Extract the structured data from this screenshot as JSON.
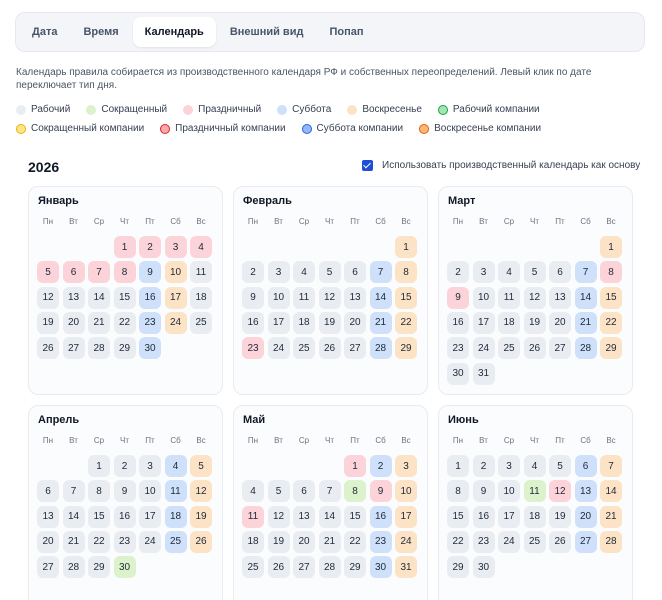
{
  "tabs": [
    "Дата",
    "Время",
    "Календарь",
    "Внешний вид",
    "Попап"
  ],
  "active_tab": 2,
  "description": "Календарь правила собирается из производственного календаря РФ и собственных переопределений. Левый клик по дате переключает тип дня.",
  "legend_row1": [
    {
      "label": "Рабочий",
      "color": "#e9edf2",
      "ring": "#e9edf2"
    },
    {
      "label": "Сокращенный",
      "color": "#dcf2cc",
      "ring": "#dcf2cc"
    },
    {
      "label": "Праздничный",
      "color": "#fbd3d8",
      "ring": "#fbd3d8"
    },
    {
      "label": "Суббота",
      "color": "#cfe0fb",
      "ring": "#cfe0fb"
    },
    {
      "label": "Воскресенье",
      "color": "#fde3c6",
      "ring": "#fde3c6"
    },
    {
      "label": "Рабочий компании",
      "color": "#a7e3b4",
      "ring": "#16a34a"
    }
  ],
  "legend_row2": [
    {
      "label": "Сокращенный компании",
      "color": "#fde68a",
      "ring": "#eab308"
    },
    {
      "label": "Праздничный компании",
      "color": "#f9a8b0",
      "ring": "#dc2626"
    },
    {
      "label": "Суббота компании",
      "color": "#93b8f7",
      "ring": "#2563eb"
    },
    {
      "label": "Воскресенье компании",
      "color": "#fdba74",
      "ring": "#ea580c"
    }
  ],
  "year": "2026",
  "use_basis_label": "Использовать производственный календарь как основу",
  "use_basis_checked": true,
  "weekdays": [
    "Пн",
    "Вт",
    "Ср",
    "Чт",
    "Пт",
    "Сб",
    "Вс"
  ],
  "day_colors": {
    "W": "#e9edf2",
    "S": "#dcf2cc",
    "H": "#fbd3d8",
    "A": "#cfe0fb",
    "U": "#fde3c6"
  },
  "months": [
    {
      "name": "Январь",
      "start": 3,
      "types": "HHHHHHHHAUWWWWWAUWWWWWAUWWWWWA"
    },
    {
      "name": "Февраль",
      "start": 6,
      "types": "UWWWWWAUWWWWWAUWWWWWAUHWWWWAU"
    },
    {
      "name": "Март",
      "start": 6,
      "types": "UWWWWWAHHWWWWAUWWWWWAUWWWWWAUWW"
    },
    {
      "name": "Апрель",
      "start": 2,
      "types": "WWWAUWWWWWAUWWWWWAUWWWWWAUWWWS"
    },
    {
      "name": "Май",
      "start": 4,
      "types": "HAUWWWWSHUHWWWWAUWWWWWAUWWWWWAU"
    },
    {
      "name": "Июнь",
      "start": 0,
      "types": "WWWWWAUWWWSHAUWWWWWAUWWWWWAUWW"
    }
  ]
}
